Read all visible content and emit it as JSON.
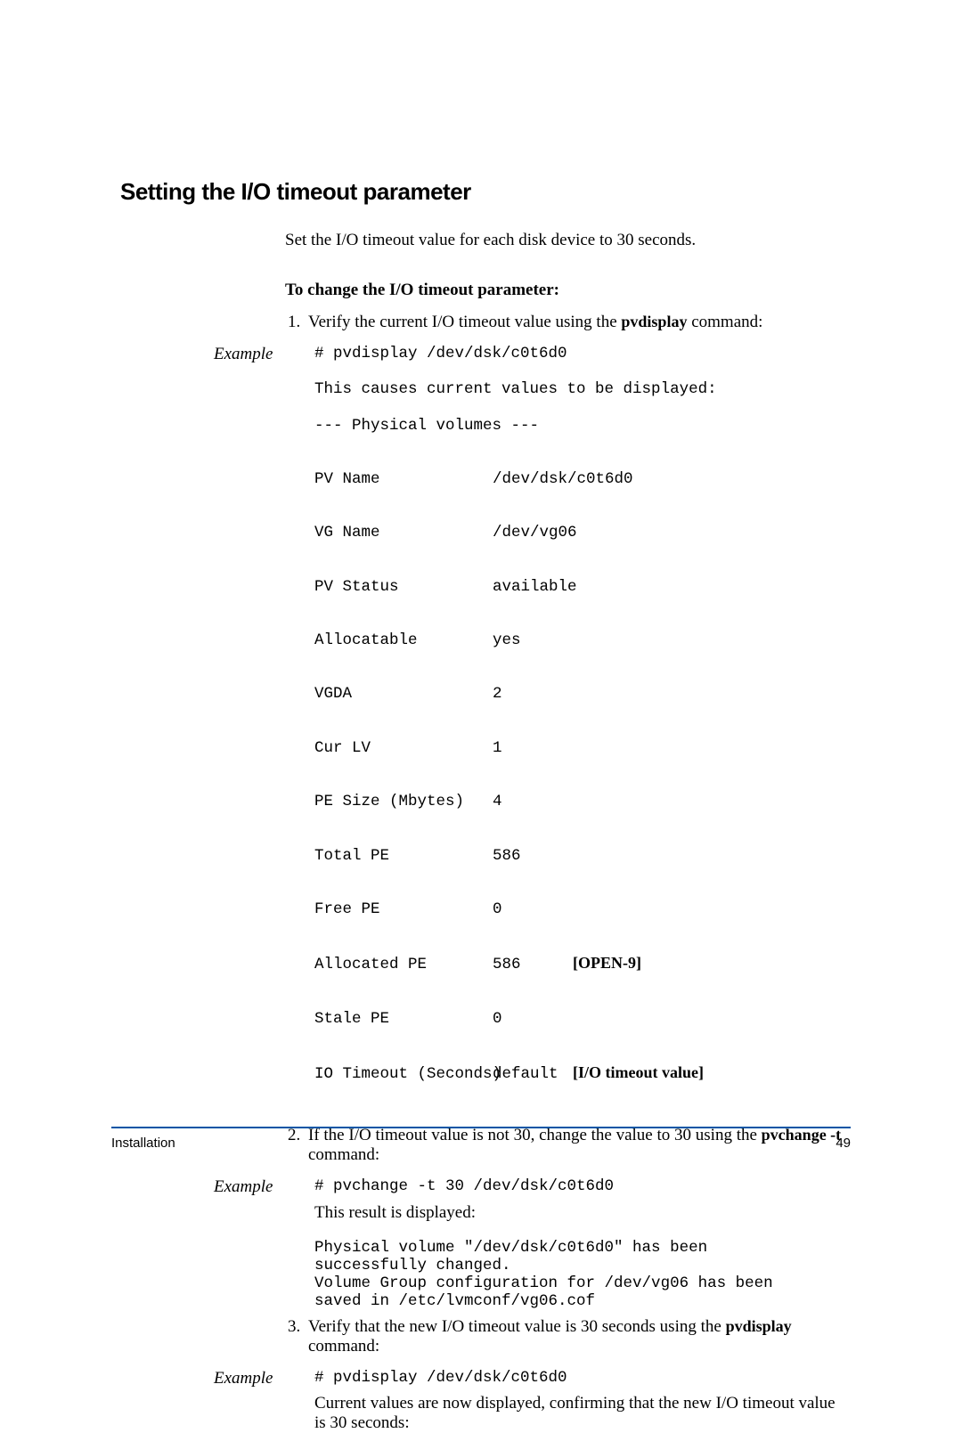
{
  "section_title": "Setting the I/O timeout parameter",
  "intro": "Set the I/O timeout value for each disk device to 30 seconds.",
  "subhead": "To change the I/O timeout parameter:",
  "steps": {
    "s1_pre": "Verify the current I/O timeout value using the ",
    "s1_bold": "pvdisplay",
    "s1_post": " command:",
    "s2_pre": "If the I/O timeout value is not 30, change the value to 30 using the ",
    "s2_bold": "pvchange -t",
    "s2_post": " command:",
    "s3_pre": "Verify that the new I/O timeout value is 30 seconds using the ",
    "s3_bold": "pvdisplay",
    "s3_post": " command:"
  },
  "example_label": "Example",
  "ex1": {
    "cmd": "# pvdisplay /dev/dsk/c0t6d0",
    "note": "This causes current values to be displayed:",
    "header": "--- Physical volumes ---",
    "rows": [
      {
        "k": "PV Name",
        "v": "/dev/dsk/c0t6d0",
        "a": ""
      },
      {
        "k": "VG Name",
        "v": "/dev/vg06",
        "a": ""
      },
      {
        "k": "PV Status",
        "v": "available",
        "a": ""
      },
      {
        "k": "Allocatable",
        "v": "yes",
        "a": ""
      },
      {
        "k": "VGDA",
        "v": "2",
        "a": ""
      },
      {
        "k": "Cur LV",
        "v": "1",
        "a": ""
      },
      {
        "k": "PE Size (Mbytes)",
        "v": "4",
        "a": ""
      },
      {
        "k": "Total PE",
        "v": "586",
        "a": ""
      },
      {
        "k": "Free PE",
        "v": "0",
        "a": ""
      },
      {
        "k": "Allocated PE",
        "v": "586",
        "a": "[OPEN-9]"
      },
      {
        "k": "Stale PE",
        "v": "0",
        "a": ""
      },
      {
        "k": "IO Timeout (Seconds)",
        "v": "default",
        "a": "[I/O timeout value]"
      }
    ]
  },
  "ex2": {
    "cmd": "# pvchange -t 30 /dev/dsk/c0t6d0",
    "note": "This result is displayed:",
    "output": "Physical volume \"/dev/dsk/c0t6d0\" has been\nsuccessfully changed.\nVolume Group configuration for /dev/vg06 has been\nsaved in /etc/lvmconf/vg06.cof"
  },
  "ex3": {
    "cmd": "# pvdisplay /dev/dsk/c0t6d0",
    "note": "Current values are now displayed, confirming that the new I/O timeout value is 30 seconds:"
  },
  "footer": {
    "left": "Installation",
    "right": "49"
  }
}
